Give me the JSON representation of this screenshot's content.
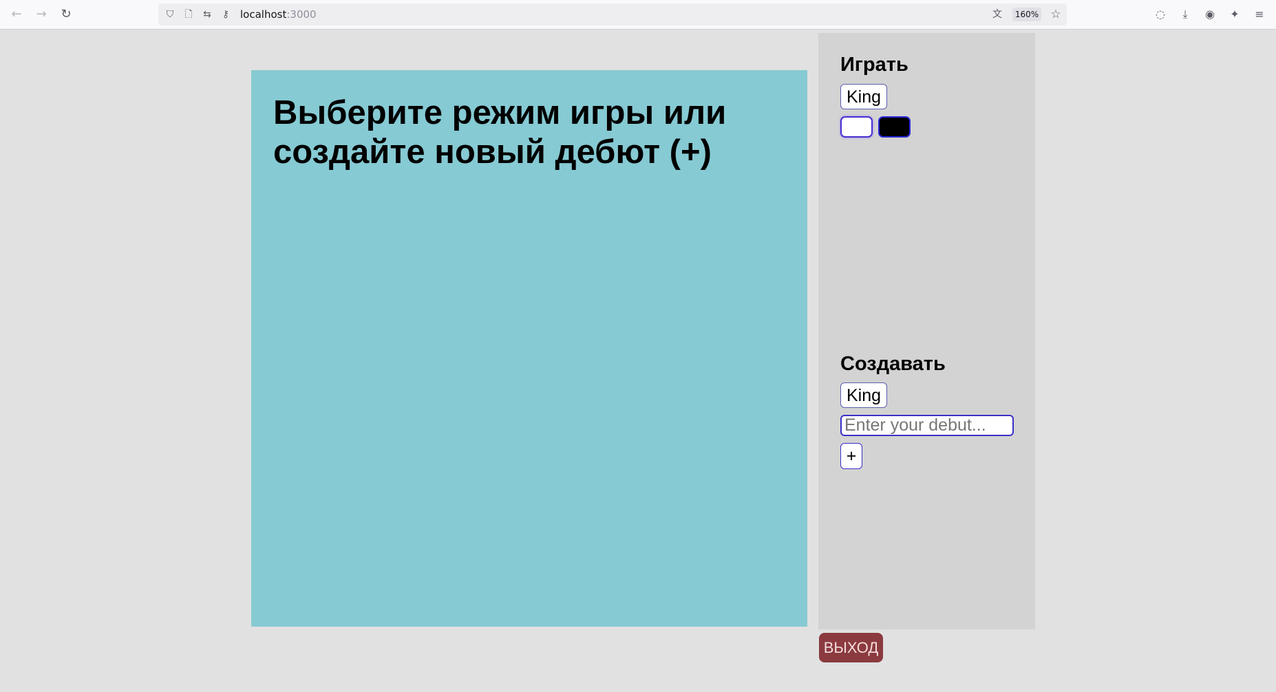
{
  "browser": {
    "url_host": "localhost",
    "url_port": ":3000",
    "zoom_label": "160%",
    "icons": {
      "back": "←",
      "forward": "→",
      "reload": "↻",
      "shield": "⛉",
      "page": "🗋",
      "permissions": "⇆",
      "key": "⚷",
      "translate": "文",
      "bookmark": "☆",
      "pocket": "◌",
      "downloads": "⤓",
      "account": "◉",
      "extensions": "✦",
      "menu": "≡"
    }
  },
  "board": {
    "heading": "Выберите режим игры или создайте новый дебют (+)",
    "background": "#86cad3"
  },
  "panel": {
    "play_title": "Играть",
    "play_piece_value": "King",
    "create_title": "Создавать",
    "create_piece_value": "King",
    "debut_placeholder": "Enter your debut...",
    "add_label": "+"
  },
  "exit_label": "ВЫХОД",
  "colors": {
    "exit_button": "#8b3a3f",
    "panel": "#d3d3d3",
    "page": "#e1e1e1"
  }
}
